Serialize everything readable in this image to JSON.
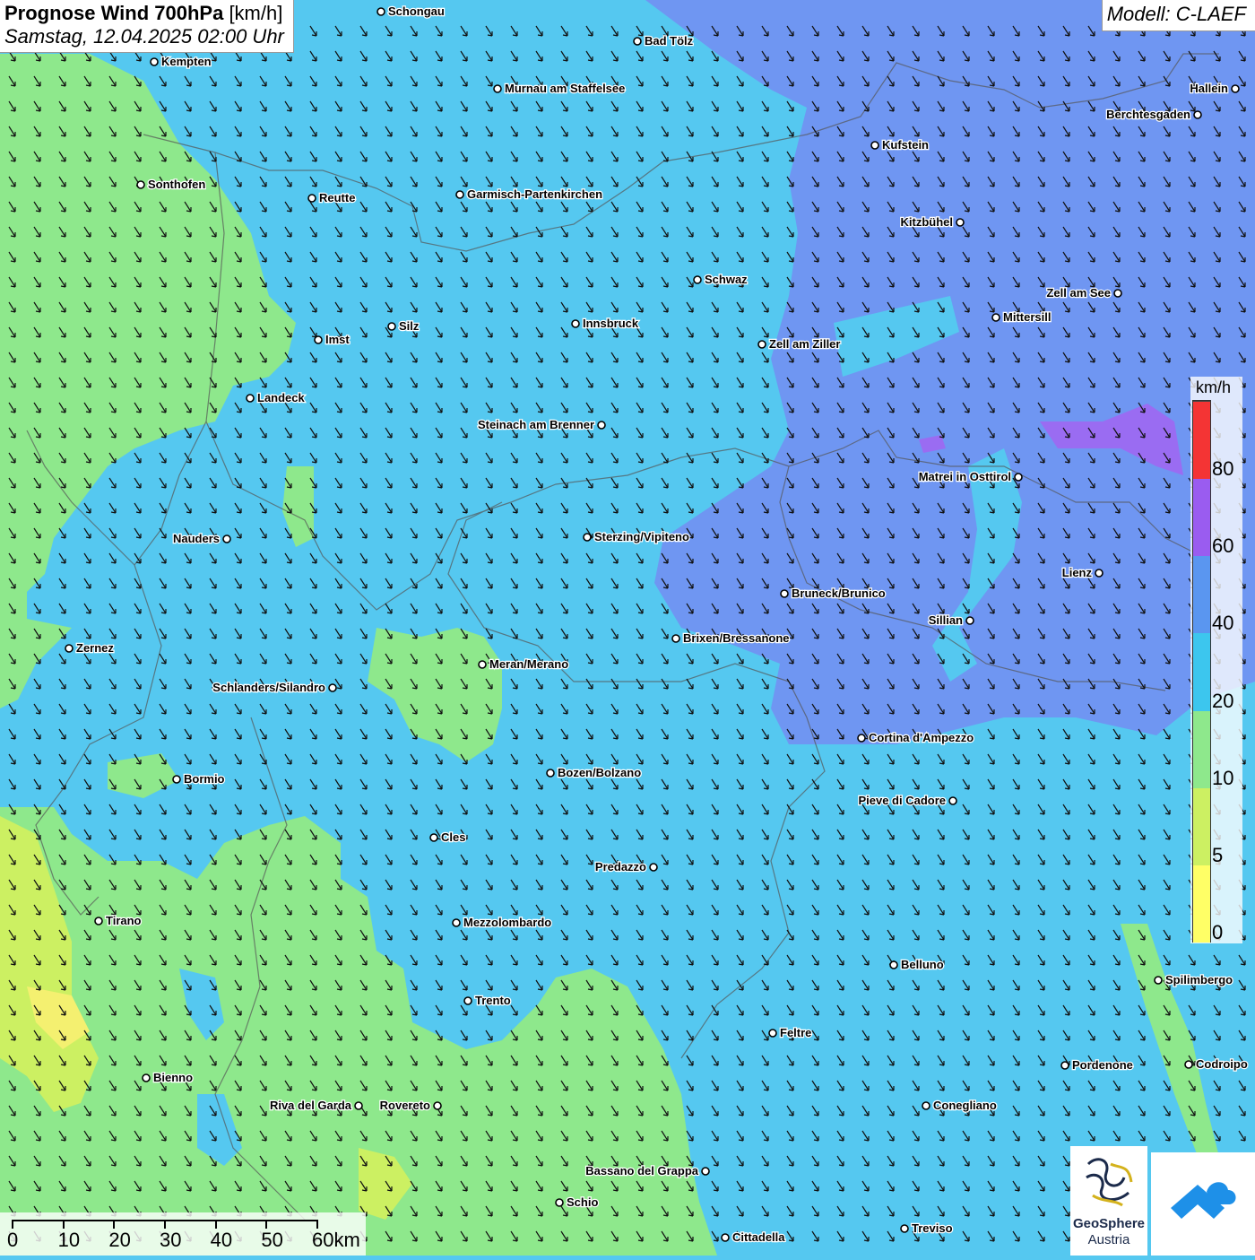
{
  "title": {
    "main": "Prognose Wind 700hPa",
    "unit": "[km/h]",
    "datetime": "Samstag, 12.04.2025 02:00 Uhr"
  },
  "model_label": "Modell: C-LAEF",
  "legend": {
    "unit": "km/h",
    "ticks": [
      "0",
      "5",
      "10",
      "20",
      "40",
      "60",
      "80"
    ],
    "colors": [
      "#ffff66",
      "#ccf062",
      "#8ee88c",
      "#3cc6ee",
      "#5a96f0",
      "#9a5cf0",
      "#f43434"
    ]
  },
  "colors": {
    "wind_10_20": "#8ee88c",
    "wind_20_40": "#55c8f0",
    "wind_40_60": "#6f96f2",
    "wind_5_10": "#ccf062",
    "wind_0_5": "#f4f070"
  },
  "wind_direction": "north-west to south-east",
  "scale_bar": {
    "labels": [
      "0",
      "10",
      "20",
      "30",
      "40",
      "50",
      "60km"
    ]
  },
  "logos": {
    "geosphere_line1": "GeoSphere",
    "geosphere_line2": "Austria"
  },
  "cities": [
    {
      "name": "Schongau"
    },
    {
      "name": "Bad Tölz"
    },
    {
      "name": "Kempten"
    },
    {
      "name": "Murnau am Staffelsee"
    },
    {
      "name": "Hallein"
    },
    {
      "name": "Berchtesgaden"
    },
    {
      "name": "Kufstein"
    },
    {
      "name": "Sonthofen"
    },
    {
      "name": "Reutte"
    },
    {
      "name": "Garmisch-Partenkirchen"
    },
    {
      "name": "Kitzbühel"
    },
    {
      "name": "Schwaz"
    },
    {
      "name": "Zell am See"
    },
    {
      "name": "Mittersill"
    },
    {
      "name": "Silz"
    },
    {
      "name": "Innsbruck"
    },
    {
      "name": "Imst"
    },
    {
      "name": "Zell am Ziller"
    },
    {
      "name": "Landeck"
    },
    {
      "name": "Steinach am Brenner"
    },
    {
      "name": "Matrei in Osttirol"
    },
    {
      "name": "Nauders"
    },
    {
      "name": "Sterzing/Vipiteno"
    },
    {
      "name": "Lienz"
    },
    {
      "name": "Bruneck/Brunico"
    },
    {
      "name": "Sillian"
    },
    {
      "name": "Zernez"
    },
    {
      "name": "Brixen/Bressanone"
    },
    {
      "name": "Meran/Merano"
    },
    {
      "name": "Schlanders/Silandro"
    },
    {
      "name": "Cortina d'Ampezzo"
    },
    {
      "name": "Bozen/Bolzano"
    },
    {
      "name": "Bormio"
    },
    {
      "name": "Pieve di Cadore"
    },
    {
      "name": "Cles"
    },
    {
      "name": "Predazzo"
    },
    {
      "name": "Tirano"
    },
    {
      "name": "Mezzolombardo"
    },
    {
      "name": "Belluno"
    },
    {
      "name": "Spilimbergo"
    },
    {
      "name": "Trento"
    },
    {
      "name": "Feltre"
    },
    {
      "name": "Pordenone"
    },
    {
      "name": "Codroipo"
    },
    {
      "name": "Bienno"
    },
    {
      "name": "Riva del Garda"
    },
    {
      "name": "Rovereto"
    },
    {
      "name": "Conegliano"
    },
    {
      "name": "Bassano del Grappa"
    },
    {
      "name": "Schio"
    },
    {
      "name": "Treviso"
    },
    {
      "name": "Cittadella"
    }
  ]
}
